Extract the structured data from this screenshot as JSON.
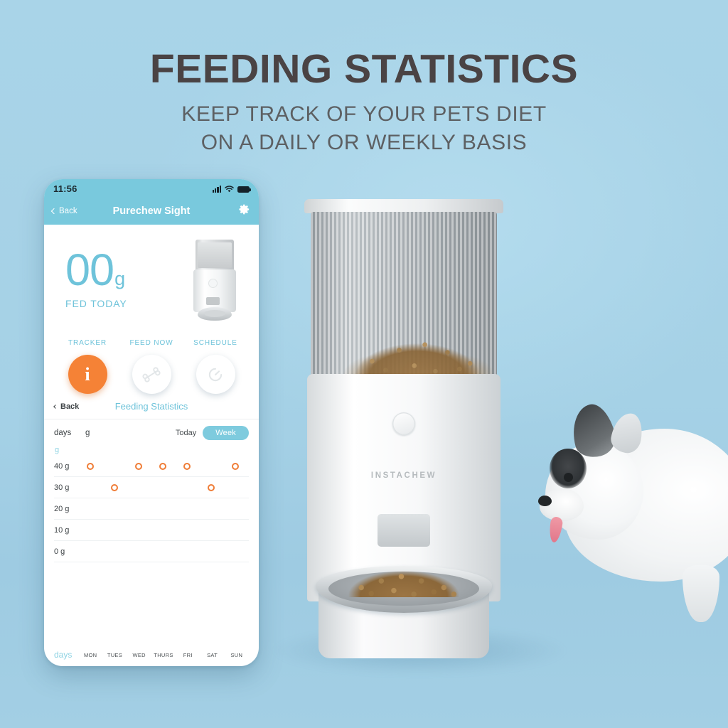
{
  "marketing": {
    "headline": "FEEDING STATISTICS",
    "subline_1": "KEEP TRACK OF YOUR PETS DIET",
    "subline_2": "ON A DAILY OR WEEKLY BASIS",
    "headline_color": "#4a4344",
    "subline_color": "#5d6063",
    "background_color": "#a8d3e8"
  },
  "product": {
    "brand": "INSTACHEW"
  },
  "phone": {
    "status_bar": {
      "time": "11:56",
      "signal_icon": "cellular-signal-icon",
      "wifi_icon": "wifi-icon",
      "battery_icon": "battery-icon"
    },
    "nav": {
      "back_label": "Back",
      "title": "Purechew Sight",
      "settings_icon": "gear-icon",
      "bar_color": "#79c9dd"
    },
    "hero": {
      "amount": "00",
      "unit": "g",
      "caption": "FED TODAY",
      "accent_color": "#6ec3da"
    },
    "actions": [
      {
        "label": "TRACKER",
        "icon": "info-icon",
        "active": true
      },
      {
        "label": "FEED NOW",
        "icon": "bone-icon",
        "active": false
      },
      {
        "label": "SCHEDULE",
        "icon": "timer-icon",
        "active": false
      }
    ],
    "active_action_color": "#f58236",
    "sub_header": {
      "back_label": "Back",
      "title": "Feeding Statistics"
    },
    "controls": {
      "days_label": "days",
      "grams_label": "g",
      "today_label": "Today",
      "week_label": "Week",
      "selected_range": "Week",
      "pill_color": "#7ecbde"
    }
  },
  "chart_data": {
    "type": "scatter",
    "title": "Feeding Statistics",
    "xlabel": "days",
    "ylabel": "g",
    "categories": [
      "MON",
      "TUES",
      "WED",
      "THURS",
      "FRI",
      "SAT",
      "SUN"
    ],
    "values": [
      40,
      30,
      40,
      40,
      40,
      30,
      40
    ],
    "ytick_labels": [
      "40 g",
      "30 g",
      "20 g",
      "10 g",
      "0 g"
    ],
    "yticks": [
      40,
      30,
      20,
      10,
      0
    ],
    "ylim": [
      0,
      40
    ],
    "grid": true,
    "legend": false,
    "marker": "hollow-circle",
    "marker_color": "#ef7d37"
  }
}
